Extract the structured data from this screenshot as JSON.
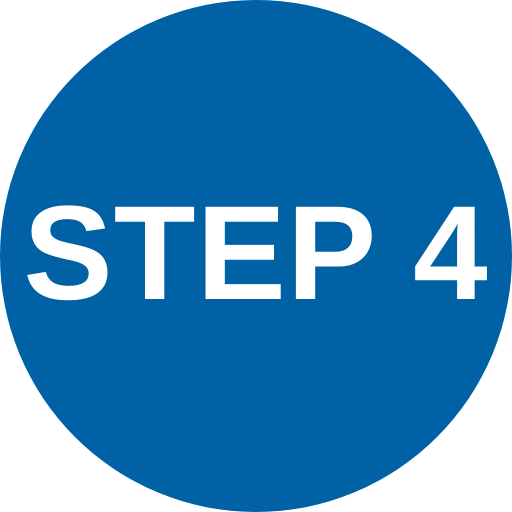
{
  "badge": {
    "label": "STEP 4",
    "shape": "circle",
    "background_color": "#0061a5",
    "text_color": "#ffffff"
  },
  "page": {
    "background_color": "#ffffff"
  }
}
